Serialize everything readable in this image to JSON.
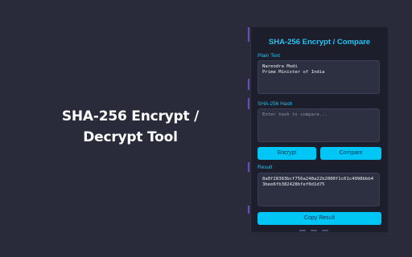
{
  "hero": {
    "title_line1": "SHA-256 Encrypt /",
    "title_line2": "Decrypt Tool"
  },
  "popup": {
    "title": "SHA-256 Encrypt / Compare",
    "plain_text": {
      "label": "Plain Text",
      "value": "Narendra Modi\nPrime Minister of India"
    },
    "hash": {
      "label": "SHA-256 Hash",
      "value": "",
      "placeholder": "Enter hash to compare..."
    },
    "buttons": {
      "encrypt_label": "Encrypt",
      "compare_label": "Compare",
      "copy_label": "Copy Result"
    },
    "result": {
      "label": "Result",
      "value": "8a0f28383bcf756a248a22b2000f1c61c4998bbb43bee6fb382428bfef0d1d75"
    }
  },
  "colors": {
    "background": "#292b3b",
    "popup_background": "#1c1e2b",
    "accent": "#22c3f2",
    "button": "#00c6f5",
    "field_background": "#2c3040"
  }
}
